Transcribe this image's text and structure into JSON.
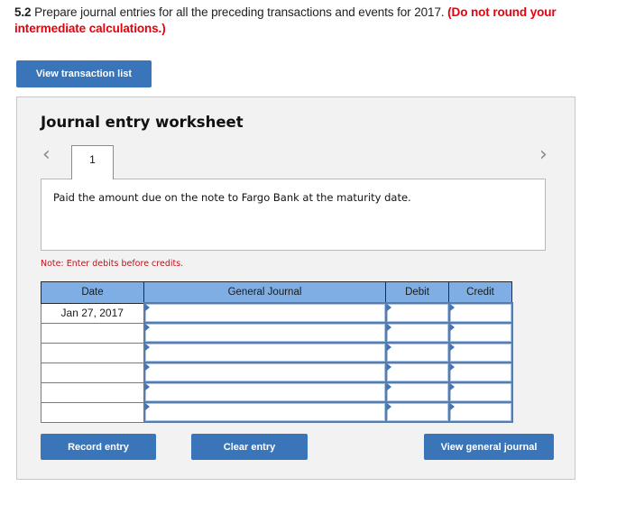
{
  "question": {
    "number": "5.2",
    "text": " Prepare journal entries for all the preceding transactions and events for 2017. ",
    "warning": "(Do not round your intermediate calculations.)"
  },
  "buttons": {
    "view_transaction_list": "View transaction list",
    "record_entry": "Record entry",
    "clear_entry": "Clear entry",
    "view_general_journal": "View general journal"
  },
  "worksheet": {
    "title": "Journal entry worksheet",
    "prev_icon": "chevron-left-icon",
    "next_icon": "chevron-right-icon",
    "prev_glyph": "‹",
    "next_glyph": "›",
    "current_tab": "1",
    "description": "Paid the amount due on the note to Fargo Bank at the maturity date.",
    "note": "Note: Enter debits before credits."
  },
  "table": {
    "headers": {
      "date": "Date",
      "general_journal": "General Journal",
      "debit": "Debit",
      "credit": "Credit"
    },
    "rows": [
      {
        "date": "Jan 27, 2017",
        "account": "",
        "debit": "",
        "credit": ""
      },
      {
        "date": "",
        "account": "",
        "debit": "",
        "credit": ""
      },
      {
        "date": "",
        "account": "",
        "debit": "",
        "credit": ""
      },
      {
        "date": "",
        "account": "",
        "debit": "",
        "credit": ""
      },
      {
        "date": "",
        "account": "",
        "debit": "",
        "credit": ""
      },
      {
        "date": "",
        "account": "",
        "debit": "",
        "credit": ""
      }
    ]
  },
  "colors": {
    "button_blue": "#3a75b9",
    "header_blue": "#7eaee3",
    "warning_red": "#e8000b",
    "note_red": "#b8141e"
  }
}
